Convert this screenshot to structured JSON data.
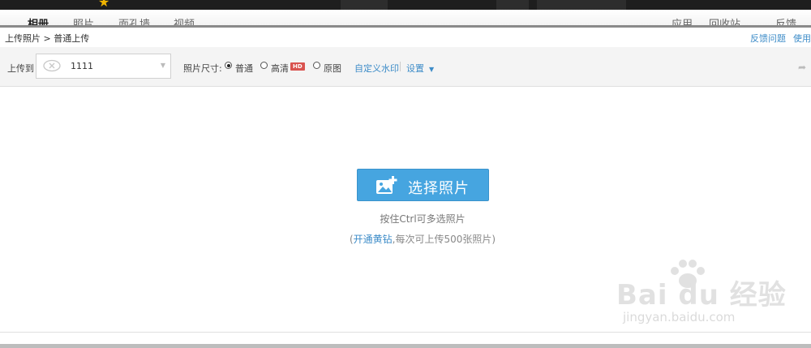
{
  "topnav": {
    "items": [
      "相册",
      "照片",
      "面孔墙",
      "视频"
    ],
    "right_items": [
      "应用",
      "回收站",
      "反馈"
    ]
  },
  "breadcrumb": {
    "root": "上传照片",
    "separator": ">",
    "current": "普通上传"
  },
  "header_links": {
    "feedback": "反馈问题",
    "help": "使用"
  },
  "toolbar": {
    "upload_to_label": "上传到",
    "album_value": "1111",
    "size_label": "照片尺寸:",
    "options": [
      {
        "label": "普通",
        "checked": true
      },
      {
        "label": "高清",
        "checked": false
      },
      {
        "label": "原图",
        "checked": false
      }
    ],
    "hd_badge": "HD",
    "watermark_link": "自定义水印",
    "settings_link": "设置"
  },
  "upload": {
    "button_label": "选择照片",
    "hint": "按住Ctrl可多选照片",
    "vip_prefix": "(",
    "vip_link": "开通黄钻",
    "vip_suffix": ",每次可上传500张照片)"
  },
  "watermark": {
    "brand": "Bai du 经验",
    "url": "jingyan.baidu.com"
  },
  "colors": {
    "accent": "#46a5e0",
    "link": "#3d8cc8",
    "hd_badge": "#d9534f"
  }
}
